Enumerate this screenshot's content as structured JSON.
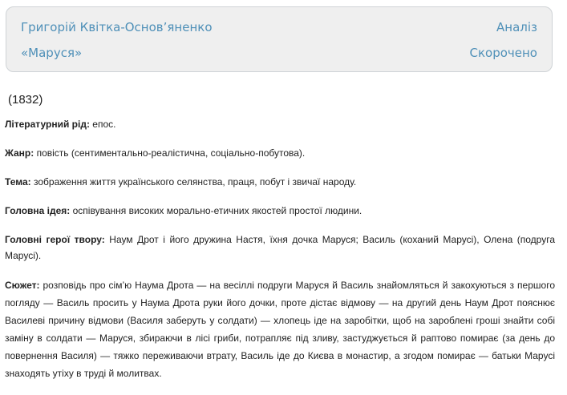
{
  "header": {
    "author": "Григорій Квітка-Основ’яненко",
    "work_title": "«Маруся»",
    "analysis_link": "Аналіз",
    "short_link": "Скорочено"
  },
  "content": {
    "year": "(1832)",
    "items": [
      {
        "label": "Літературний рід:",
        "text": " епос."
      },
      {
        "label": "Жанр:",
        "text": " повість (сентиментально-реалістична, соціально-побутова)."
      },
      {
        "label": "Тема:",
        "text": " зображення життя українського селянства, праця, побут і звичаї народу."
      },
      {
        "label": "Головна ідея:",
        "text": " оспівування високих морально-етичних якостей простої людини."
      },
      {
        "label": "Головні герої твору:",
        "text": " Наум Дрот і його дружина Настя, їхня дочка Маруся; Василь (коханий Марусі), Олена (подруга Марусі)."
      },
      {
        "label": "Сюжет:",
        "text": " розповідь про сім’ю Наума Дрота — на весіллі подруги Маруся й Василь знайомляться й закохуються з першого погляду — Василь просить у Наума Дрота руки його дочки, проте дістає відмову — на другий день Наум Дрот пояснює Василеві причину відмови (Василя заберуть у солдати) — хлопець іде на заробітки, щоб на зароблені гроші знайти собі заміну в солдати — Маруся, збираючи в лісі гриби, потрапляє під зливу, застуджується й раптово помирає (за день до повернення Василя) — тяжко переживаючи втрату, Василь іде до Києва в монастир, а згодом помирає — батьки Марусі знаходять утіху в труді й молитвах."
      }
    ]
  }
}
